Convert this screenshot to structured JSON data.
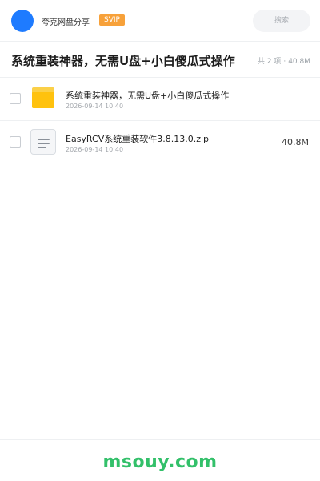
{
  "header": {
    "brand": "夸克网盘分享",
    "badge": "SVIP",
    "search_placeholder": "搜索"
  },
  "share": {
    "title": "系统重装神器，无需U盘+小白傻瓜式操作",
    "count_text": "共 2 项",
    "separator": "·",
    "total_size": "40.8M"
  },
  "files": [
    {
      "name": "系统重装神器，无需U盘+小白傻瓜式操作",
      "time": "2026-09-14 10:40",
      "type": "folder-icon",
      "size": ""
    },
    {
      "name": "EasyRCV系统重装软件3.8.13.0.zip",
      "time": "2026-09-14 10:40",
      "type": "file-icon",
      "size": "40.8M"
    }
  ],
  "footer": {
    "watermark": "msouy.com"
  },
  "colors": {
    "accent": "#1e7bff",
    "badge": "#f7a13a",
    "folder": "#ffc20e",
    "watermark": "#33c06a"
  }
}
